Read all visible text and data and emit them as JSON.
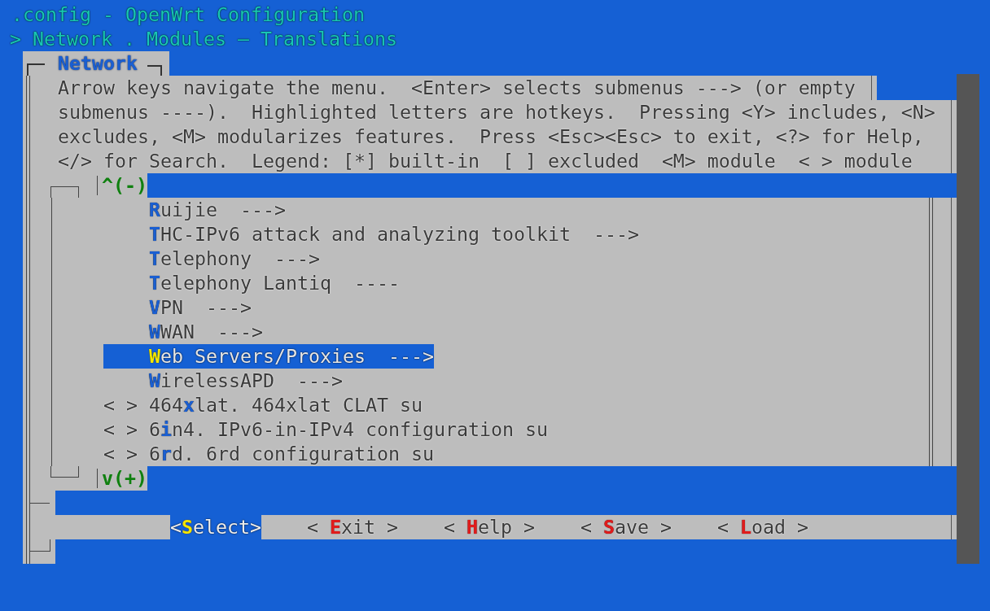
{
  "window": {
    "title": ".config - OpenWrt Configuration"
  },
  "breadcrumb": "> Network . Modules — Translations",
  "dialog": {
    "title": "Network",
    "help_lines": [
      "Arrow keys navigate the menu.  <Enter> selects submenus ---> (or empty",
      "submenus ----).  Highlighted letters are hotkeys.  Pressing <Y> includes, <N>",
      "excludes, <M> modularizes features.  Press <Esc><Esc> to exit, <?> for Help,",
      "</> for Search.  Legend: [*] built-in  [ ] excluded  <M> module  < > module"
    ],
    "scroll_up": "^(-)",
    "scroll_down": "v(+)"
  },
  "menu_items": [
    {
      "kind": "submenu",
      "hotkey": "R",
      "after": "uijie  --->",
      "selected": false
    },
    {
      "kind": "submenu",
      "hotkey": "T",
      "after": "HC-IPv6 attack and analyzing toolkit  --->",
      "selected": false
    },
    {
      "kind": "submenu",
      "hotkey": "T",
      "after": "elephony  --->",
      "selected": false
    },
    {
      "kind": "submenu",
      "hotkey": "T",
      "after": "elephony Lantiq  ----",
      "selected": false
    },
    {
      "kind": "submenu",
      "hotkey": "V",
      "after": "PN  --->",
      "selected": false
    },
    {
      "kind": "submenu",
      "hotkey": "W",
      "after": "WAN  --->",
      "selected": false
    },
    {
      "kind": "submenu",
      "hotkey": "W",
      "after": "eb Servers/Proxies  --->",
      "selected": true
    },
    {
      "kind": "submenu",
      "hotkey": "W",
      "after": "irelessAPD  --->",
      "selected": false
    },
    {
      "kind": "module",
      "marker": "< >",
      "before": "464",
      "hotkey": "x",
      "after": "lat. 464xlat CLAT su",
      "selected": false
    },
    {
      "kind": "module",
      "marker": "< >",
      "before": "6",
      "hotkey": "i",
      "after": "n4. IPv6-in-IPv4 configuration su",
      "selected": false
    },
    {
      "kind": "module",
      "marker": "< >",
      "before": "6",
      "hotkey": "r",
      "after": "d. 6rd configuration su",
      "selected": false
    }
  ],
  "buttons": [
    {
      "before": "<",
      "hotkey": "S",
      "after": "elect>",
      "selected": true
    },
    {
      "before": "< ",
      "hotkey": "E",
      "after": "xit >",
      "selected": false
    },
    {
      "before": "< ",
      "hotkey": "H",
      "after": "elp >",
      "selected": false
    },
    {
      "before": "< ",
      "hotkey": "S",
      "after": "ave >",
      "selected": false
    },
    {
      "before": "< ",
      "hotkey": "L",
      "after": "oad >",
      "selected": false
    }
  ]
}
